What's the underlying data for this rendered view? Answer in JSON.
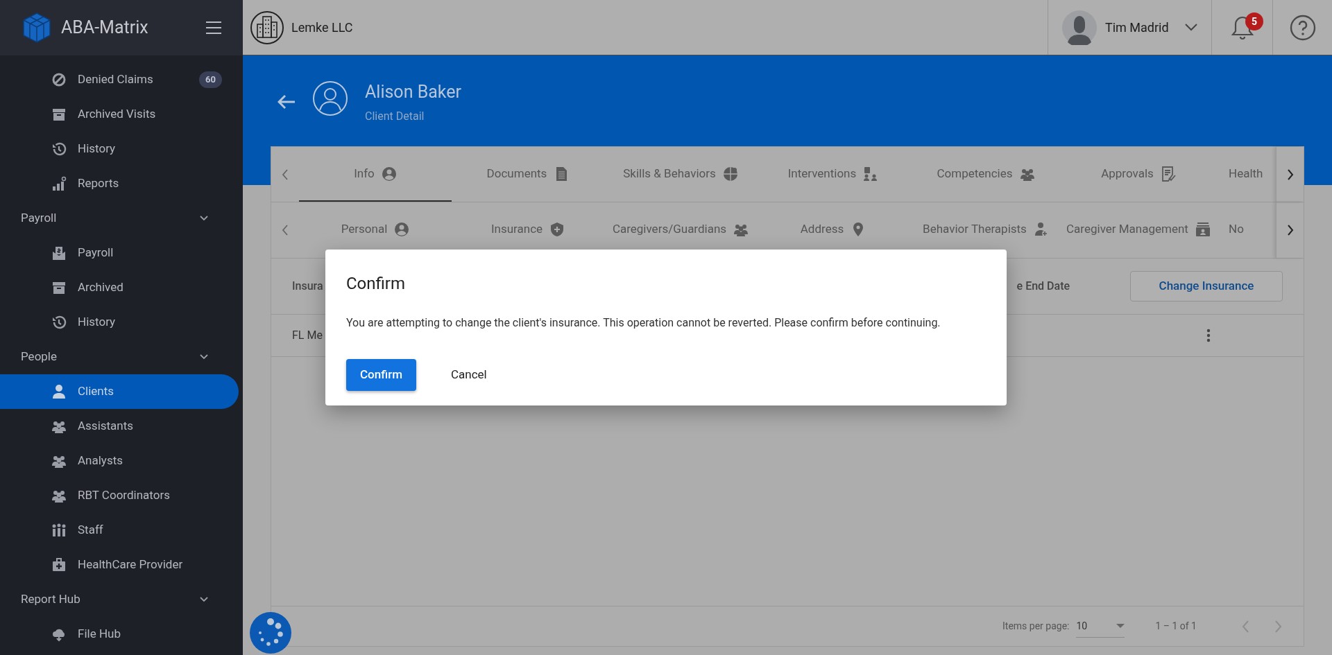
{
  "sidebar": {
    "brand": "ABA-Matrix",
    "items": [
      {
        "kind": "link",
        "label": "Denied Claims",
        "badge": "60",
        "selected": false
      },
      {
        "kind": "link",
        "label": "Archived Visits",
        "selected": false
      },
      {
        "kind": "link",
        "label": "History",
        "selected": false
      },
      {
        "kind": "link",
        "label": "Reports",
        "selected": false
      },
      {
        "kind": "section",
        "label": "Payroll",
        "expanded": true,
        "children": [
          {
            "kind": "link",
            "label": "Payroll",
            "selected": false
          },
          {
            "kind": "link",
            "label": "Archived",
            "selected": false
          },
          {
            "kind": "link",
            "label": "History",
            "selected": false
          }
        ]
      },
      {
        "kind": "section",
        "label": "People",
        "expanded": true,
        "children": [
          {
            "kind": "link",
            "label": "Clients",
            "selected": true
          },
          {
            "kind": "link",
            "label": "Assistants",
            "selected": false
          },
          {
            "kind": "link",
            "label": "Analysts",
            "selected": false
          },
          {
            "kind": "link",
            "label": "RBT Coordinators",
            "selected": false
          },
          {
            "kind": "link",
            "label": "Staff",
            "selected": false
          },
          {
            "kind": "link",
            "label": "HealthCare Provider",
            "selected": false
          }
        ]
      },
      {
        "kind": "section",
        "label": "Report Hub",
        "expanded": true,
        "children": [
          {
            "kind": "link",
            "label": "File Hub",
            "selected": false
          }
        ]
      }
    ]
  },
  "topbar": {
    "company": "Lemke LLC",
    "user": "Tim Madrid",
    "notifications": "5"
  },
  "header": {
    "title": "Alison Baker",
    "subtitle": "Client Detail"
  },
  "tabs": [
    {
      "label": "Info",
      "selected": true
    },
    {
      "label": "Documents",
      "selected": false
    },
    {
      "label": "Skills & Behaviors",
      "selected": false
    },
    {
      "label": "Interventions",
      "selected": false
    },
    {
      "label": "Competencies",
      "selected": false
    },
    {
      "label": "Approvals",
      "selected": false
    },
    {
      "label": "Health",
      "selected": false
    }
  ],
  "subtabs": [
    {
      "label": "Personal"
    },
    {
      "label": "Insurance"
    },
    {
      "label": "Caregivers/Guardians"
    },
    {
      "label": "Address"
    },
    {
      "label": "Behavior Therapists"
    },
    {
      "label": "Caregiver Management"
    },
    {
      "label": "No"
    }
  ],
  "table": {
    "columns": [
      {
        "label": "Insura"
      },
      {
        "label": "e End Date"
      }
    ],
    "action": "Change Insurance",
    "rows": [
      {
        "cells": [
          "FL Me"
        ]
      }
    ]
  },
  "pagination": {
    "label": "Items per page:",
    "page_size": "10",
    "range": "1 – 1 of 1"
  },
  "dialog": {
    "title": "Confirm",
    "message": "You are attempting to change the client's insurance. This operation cannot be reverted. Please confirm before continuing.",
    "buttons": [
      {
        "label": "Confirm",
        "kind": "primary"
      },
      {
        "label": "Cancel",
        "kind": "text"
      }
    ]
  }
}
